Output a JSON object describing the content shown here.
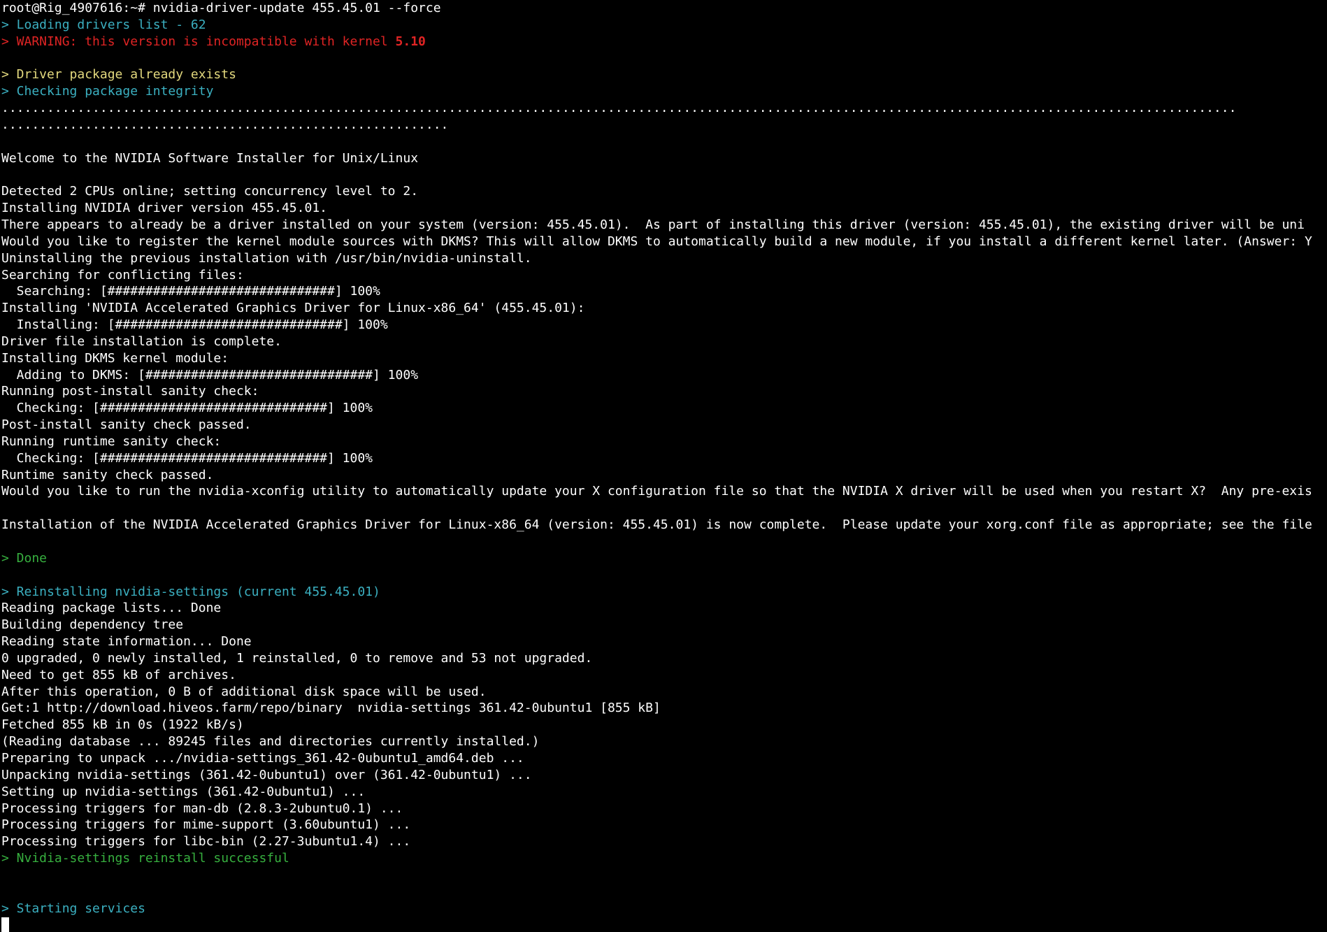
{
  "colors": {
    "background": "#000000",
    "default": "#ffffff",
    "cyan": "#3bb0c1",
    "red": "#e02424",
    "yellow": "#e3d97e",
    "green": "#37b03f",
    "highlight": "#f2f2f2"
  },
  "lines": [
    {
      "segments": [
        {
          "text": "root@Rig_4907616:~# nvidia-driver-update 455.45.01 --force",
          "color": "default"
        }
      ]
    },
    {
      "segments": [
        {
          "text": "> Loading drivers list - 62",
          "color": "cyan"
        }
      ]
    },
    {
      "segments": [
        {
          "text": "> WARNING: this version is incompatible with kernel ",
          "color": "red"
        },
        {
          "text": "5.10",
          "color": "red",
          "bold": true
        }
      ]
    },
    {
      "segments": [
        {
          "text": "",
          "color": "default"
        }
      ]
    },
    {
      "segments": [
        {
          "text": "> Driver package already exists",
          "color": "yellow"
        }
      ]
    },
    {
      "segments": [
        {
          "text": "> Checking package integrity",
          "color": "cyan"
        }
      ]
    },
    {
      "segments": [
        {
          "text": "...................................................................................................................................................................",
          "color": "default"
        }
      ]
    },
    {
      "segments": [
        {
          "text": "...........................................................",
          "color": "default"
        }
      ]
    },
    {
      "segments": [
        {
          "text": "",
          "color": "default"
        }
      ]
    },
    {
      "segments": [
        {
          "text": "Welcome to the NVIDIA Software Installer for Unix/Linux",
          "color": "default"
        }
      ]
    },
    {
      "segments": [
        {
          "text": "",
          "color": "default"
        }
      ]
    },
    {
      "segments": [
        {
          "text": "Detected 2 CPUs online; setting concurrency level to 2.",
          "color": "default"
        }
      ]
    },
    {
      "segments": [
        {
          "text": "Installing NVIDIA driver version 455.45.01.",
          "color": "default"
        }
      ]
    },
    {
      "segments": [
        {
          "text": "There appears to already be a driver installed on your system (version: 455.45.01).  As part of installing this driver (version: 455.45.01), the existing driver will be uni",
          "color": "default"
        }
      ]
    },
    {
      "segments": [
        {
          "text": "Would you like to register the kernel module sources with DKMS? This will allow DKMS to automatically build a new module, if you install a different kernel later. (Answer: Y",
          "color": "default"
        }
      ]
    },
    {
      "segments": [
        {
          "text": "Uninstalling the previous installation with /usr/bin/nvidia-uninstall.",
          "color": "default"
        }
      ]
    },
    {
      "segments": [
        {
          "text": "Searching for conflicting files:",
          "color": "default"
        }
      ]
    },
    {
      "segments": [
        {
          "text": "  Searching: [##############################] 100%",
          "color": "default"
        }
      ]
    },
    {
      "segments": [
        {
          "text": "Installing 'NVIDIA Accelerated Graphics Driver for Linux-x86_64' (455.45.01):",
          "color": "default"
        }
      ]
    },
    {
      "segments": [
        {
          "text": "  Installing: [##############################] 100%",
          "color": "default"
        }
      ]
    },
    {
      "segments": [
        {
          "text": "Driver file installation is complete.",
          "color": "default"
        }
      ]
    },
    {
      "segments": [
        {
          "text": "Installing DKMS kernel module:",
          "color": "default"
        }
      ]
    },
    {
      "segments": [
        {
          "text": "  Adding to DKMS: [##############################] 100%",
          "color": "default"
        }
      ]
    },
    {
      "segments": [
        {
          "text": "Running post-install sanity check:",
          "color": "default"
        }
      ]
    },
    {
      "segments": [
        {
          "text": "  Checking: [##############################] 100%",
          "color": "default"
        }
      ]
    },
    {
      "segments": [
        {
          "text": "Post-install sanity check passed.",
          "color": "default"
        }
      ]
    },
    {
      "segments": [
        {
          "text": "Running runtime sanity check:",
          "color": "default"
        }
      ]
    },
    {
      "segments": [
        {
          "text": "  Checking: [##############################] 100%",
          "color": "default"
        }
      ]
    },
    {
      "segments": [
        {
          "text": "Runtime sanity check passed.",
          "color": "default"
        }
      ]
    },
    {
      "segments": [
        {
          "text": "Would you like to run the nvidia-xconfig utility to automatically update your X configuration file so that the NVIDIA X driver will be used when you restart X?  Any pre-exis",
          "color": "default"
        }
      ]
    },
    {
      "segments": [
        {
          "text": "",
          "color": "default"
        }
      ]
    },
    {
      "segments": [
        {
          "text": "Installation of the NVIDIA Accelerated Graphics Driver for Linux-x86_64 (version: 455.45.01) is now complete.  Please update your xorg.conf file as appropriate; see the file",
          "color": "default"
        }
      ]
    },
    {
      "segments": [
        {
          "text": "",
          "color": "default"
        }
      ]
    },
    {
      "segments": [
        {
          "text": "> Done",
          "color": "green"
        }
      ]
    },
    {
      "segments": [
        {
          "text": "",
          "color": "default"
        }
      ]
    },
    {
      "segments": [
        {
          "text": "> Reinstalling nvidia-settings (current 455.45.01)",
          "color": "cyan"
        }
      ]
    },
    {
      "segments": [
        {
          "text": "Reading package lists... Done",
          "color": "default"
        }
      ]
    },
    {
      "segments": [
        {
          "text": "Building dependency tree",
          "color": "default"
        }
      ]
    },
    {
      "segments": [
        {
          "text": "Reading state information... Done",
          "color": "default"
        }
      ]
    },
    {
      "segments": [
        {
          "text": "0 upgraded, 0 newly installed, 1 reinstalled, 0 to remove and 53 not upgraded.",
          "color": "default"
        }
      ]
    },
    {
      "segments": [
        {
          "text": "Need to get 855 kB of archives.",
          "color": "default"
        }
      ]
    },
    {
      "segments": [
        {
          "text": "After this operation, 0 B of additional disk space will be used.",
          "color": "default"
        }
      ]
    },
    {
      "segments": [
        {
          "text": "Get:1 http://download.hiveos.farm/repo/binary  nvidia-settings 361.42-0ubuntu1 [855 kB]",
          "color": "default"
        }
      ]
    },
    {
      "segments": [
        {
          "text": "Fetched 855 kB in 0s (1922 kB/s)",
          "color": "default"
        }
      ]
    },
    {
      "segments": [
        {
          "text": "(Reading database ... 89245 files and directories currently installed.)",
          "color": "default"
        }
      ]
    },
    {
      "segments": [
        {
          "text": "Preparing to unpack .../nvidia-settings_361.42-0ubuntu1_amd64.deb ...",
          "color": "default"
        }
      ]
    },
    {
      "segments": [
        {
          "text": "Unpacking nvidia-settings (361.42-0ubuntu1) over (361.42-0ubuntu1) ...",
          "color": "default"
        }
      ]
    },
    {
      "segments": [
        {
          "text": "Setting up nvidia-settings (361.42-0ubuntu1) ...",
          "color": "default"
        }
      ]
    },
    {
      "segments": [
        {
          "text": "Processing triggers for man-db (2.8.3-2ubuntu0.1) ...",
          "color": "default"
        }
      ]
    },
    {
      "segments": [
        {
          "text": "Processing triggers for mime-support (3.60ubuntu1) ...",
          "color": "default"
        }
      ]
    },
    {
      "segments": [
        {
          "text": "Processing triggers for libc-bin (2.27-3ubuntu1.4) ...",
          "color": "default"
        }
      ]
    },
    {
      "segments": [
        {
          "text": "> Nvidia-settings reinstall successful",
          "color": "green"
        }
      ]
    },
    {
      "segments": [
        {
          "text": "",
          "color": "default"
        }
      ]
    },
    {
      "segments": [
        {
          "text": "",
          "color": "default"
        }
      ]
    },
    {
      "segments": [
        {
          "text": "> Starting services",
          "color": "cyan"
        }
      ]
    }
  ]
}
